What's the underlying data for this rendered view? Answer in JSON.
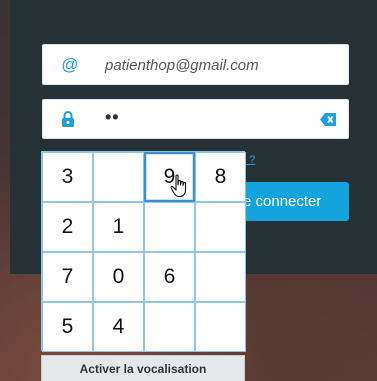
{
  "login": {
    "email_icon": "@",
    "email_value": "patienthop@gmail.com",
    "password_mask": "••",
    "forgot_link_text": "é ?",
    "submit_label": "e connecter"
  },
  "keypad": {
    "keys": [
      "3",
      "",
      "9",
      "8",
      "2",
      "1",
      "",
      "",
      "7",
      "0",
      "6",
      "",
      "5",
      "4",
      "",
      ""
    ],
    "active_key": "9"
  },
  "vocalisation_label": "Activer la vocalisation",
  "icons": {
    "email": "at-icon",
    "password": "lock-icon",
    "clear": "backspace-icon",
    "pointer": "hand-cursor-icon"
  },
  "colors": {
    "panel": "#263135",
    "accent": "#13a3dd",
    "keypad_border": "#8fc5e6"
  }
}
